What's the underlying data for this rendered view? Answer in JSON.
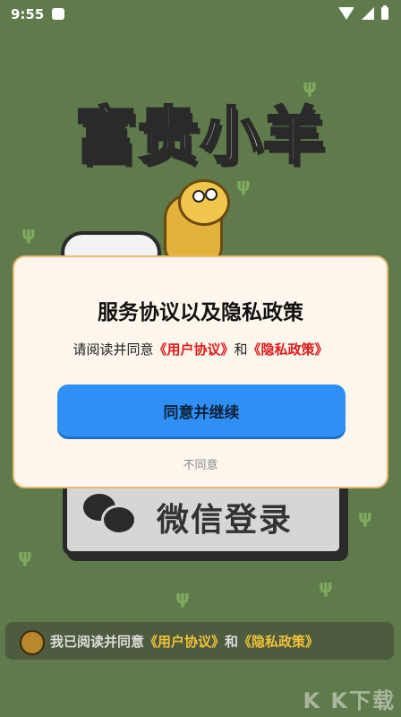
{
  "status": {
    "time": "9:55"
  },
  "game": {
    "title": "富贵小羊"
  },
  "login": {
    "wechat_label": "微信登录"
  },
  "agreement": {
    "prefix": "我已阅读并同意",
    "user_link": "《用户协议》",
    "and": "和",
    "privacy_link": "《隐私政策》"
  },
  "dialog": {
    "title": "服务协议以及隐私政策",
    "body_prefix": "请阅读并同意",
    "user_link": "《用户协议》",
    "and": "和",
    "privacy_link": "《隐私政策》",
    "confirm": "同意并继续",
    "decline": "不同意"
  },
  "watermark": "K K下载",
  "colors": {
    "background": "#5f7b4b",
    "primary": "#2e8ff5",
    "link_red": "#e01a1a",
    "link_gold": "#f0c13a"
  }
}
